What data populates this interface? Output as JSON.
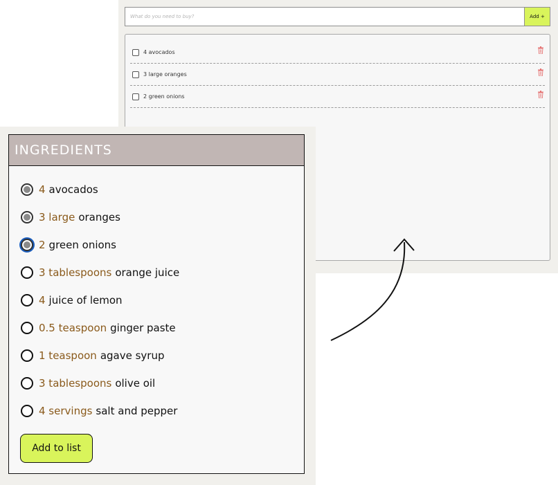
{
  "shopping": {
    "input_placeholder": "What do you need to buy?",
    "add_label": "Add +",
    "items": [
      {
        "text": "4 avocados"
      },
      {
        "text": "3 large oranges"
      },
      {
        "text": "2 green onions"
      }
    ]
  },
  "ingredients": {
    "title": "INGREDIENTS",
    "items": [
      {
        "qty": "4",
        "name": "avocados",
        "checked": true
      },
      {
        "qty": "3 large",
        "name": "oranges",
        "checked": true
      },
      {
        "qty": "2",
        "name": "green onions",
        "checked": true,
        "focused": true
      },
      {
        "qty": "3 tablespoons",
        "name": "orange juice",
        "checked": false
      },
      {
        "qty": "4",
        "name": "juice of lemon",
        "checked": false
      },
      {
        "qty": "0.5 teaspoon",
        "name": "ginger paste",
        "checked": false
      },
      {
        "qty": "1 teaspoon",
        "name": "agave syrup",
        "checked": false
      },
      {
        "qty": "3 tablespoons",
        "name": "olive oil",
        "checked": false
      },
      {
        "qty": "4 servings",
        "name": "salt and pepper",
        "checked": false
      }
    ],
    "button_label": "Add to list"
  },
  "colors": {
    "accent_green": "#d9f45b",
    "header_bg": "#c1b6b4",
    "quantity_brown": "#8a5a1b",
    "delete_red": "#e57373"
  },
  "icons": {
    "delete": "trash-icon",
    "connector": "curved-arrow-icon"
  }
}
